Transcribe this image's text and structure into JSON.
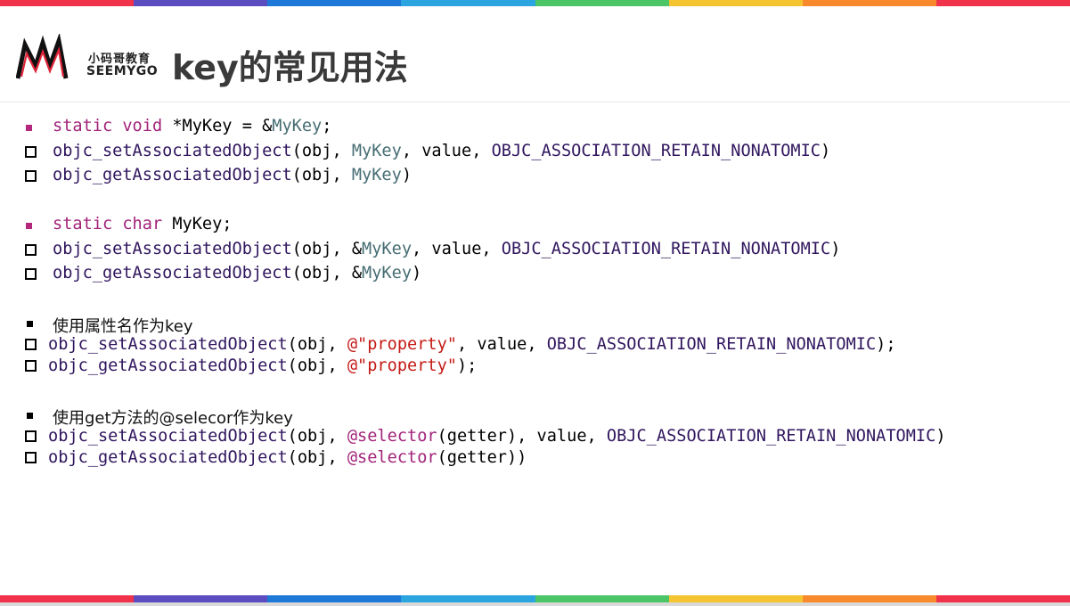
{
  "colors": {
    "stripe": [
      "#f0334b",
      "#5b4cc0",
      "#1e78d8",
      "#2aa5df",
      "#4cc567",
      "#f5c431",
      "#f88a2d",
      "#f0334b"
    ],
    "keyword": "#a2237a",
    "function": "#30165e",
    "variable": "#466d73",
    "string": "#c41a16"
  },
  "logo": {
    "chinese": "小码哥教育",
    "english": "SEEMYGO",
    "icon": "seemygo-m-logo-icon"
  },
  "title": "key的常见用法",
  "sections": [
    {
      "decl": [
        "static void",
        " *MyKey = &",
        "MyKey",
        ";"
      ],
      "set": [
        "objc_setAssociatedObject",
        "(obj, ",
        "MyKey",
        ", value, ",
        "OBJC_ASSOCIATION_RETAIN_NONATOMIC",
        ")"
      ],
      "get": [
        "objc_getAssociatedObject",
        "(obj, ",
        "MyKey",
        ")"
      ]
    },
    {
      "decl": [
        "static char",
        " MyKey;"
      ],
      "set": [
        "objc_setAssociatedObject",
        "(obj, &",
        "MyKey",
        ", value, ",
        "OBJC_ASSOCIATION_RETAIN_NONATOMIC",
        ")"
      ],
      "get": [
        "objc_getAssociatedObject",
        "(obj, &",
        "MyKey",
        ")"
      ]
    },
    {
      "heading": "使用属性名作为key",
      "set": [
        "objc_setAssociatedObject",
        "(obj, ",
        "@\"property\"",
        ", value, ",
        "OBJC_ASSOCIATION_RETAIN_NONATOMIC",
        ");"
      ],
      "get": [
        "objc_getAssociatedObject",
        "(obj, ",
        "@\"property\"",
        ");"
      ]
    },
    {
      "heading": "使用get方法的@selecor作为key",
      "set": [
        "objc_setAssociatedObject",
        "(obj, ",
        "@selector",
        "(getter), value, ",
        "OBJC_ASSOCIATION_RETAIN_NONATOMIC",
        ")"
      ],
      "get": [
        "objc_getAssociatedObject",
        "(obj, ",
        "@selector",
        "(getter))"
      ]
    }
  ]
}
